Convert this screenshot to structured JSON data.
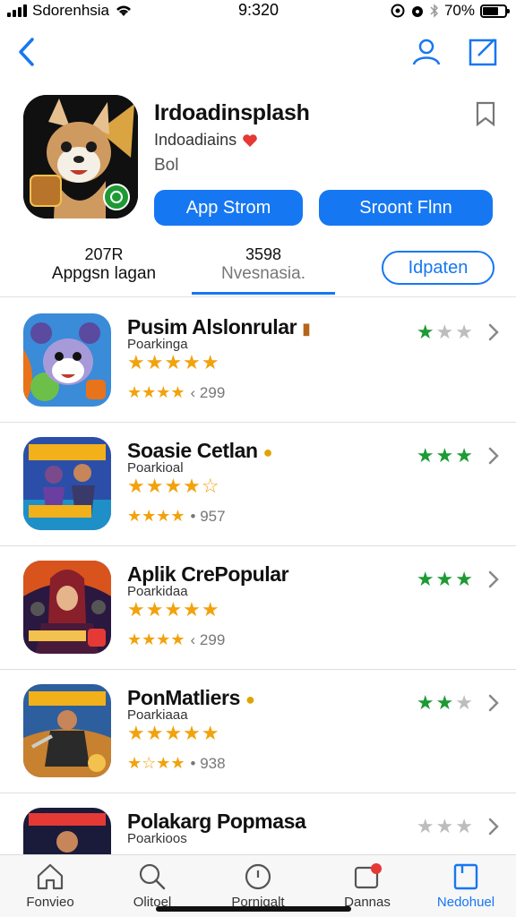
{
  "status_bar": {
    "carrier": "Sdorenhsia",
    "time": "9:320",
    "battery": "70%",
    "battery_level": 0.7
  },
  "hero": {
    "title": "Irdoadinsplash",
    "subtitle": "Indoadiains",
    "category": "Bol",
    "buttons": [
      "App Strom",
      "Sroont Flnn"
    ]
  },
  "tabs": [
    {
      "number": "207R",
      "label": "Appgsn lagan"
    },
    {
      "number": "3598",
      "label": "Nvesnasia."
    }
  ],
  "pill": {
    "label": "Idpaten"
  },
  "apps": [
    {
      "title": "Pusim Alslonrular",
      "developer": "Poarkinga",
      "stars_big": "★★★★★",
      "stars_small": "★★★★",
      "count": "‹ 299",
      "rating": 1,
      "accent": "#b5641a"
    },
    {
      "title": "Soasie Cetlan",
      "developer": "Poarkioal",
      "stars_big": "★★★★☆",
      "stars_small": "★★★★",
      "count": "• 957",
      "rating": 3,
      "accent": "#e0a400"
    },
    {
      "title": "Aplik CrePopular",
      "developer": "Poarkidaa",
      "stars_big": "★★★★★",
      "stars_small": "★★★★",
      "count": "‹ 299",
      "rating": 3,
      "accent": "#c2185b"
    },
    {
      "title": "PonMatliers",
      "developer": "Poarkiaaa",
      "stars_big": "★★★★★",
      "stars_small": "★☆★★",
      "count": "• 938",
      "rating": 2,
      "accent": "#e0a400"
    },
    {
      "title": "Polakarg Popmasa",
      "developer": "Poarkioos",
      "stars_big": "",
      "stars_small": "",
      "count": "",
      "rating": 0,
      "accent": "#1677f2"
    }
  ],
  "tabbar": [
    {
      "label": "Fonvieo",
      "icon": "home-icon"
    },
    {
      "label": "Olitoel",
      "icon": "search-icon"
    },
    {
      "label": "Porniqalt",
      "icon": "clock-icon"
    },
    {
      "label": "Dannas",
      "icon": "notifications-icon"
    },
    {
      "label": "Nedohuel",
      "icon": "updates-icon"
    }
  ],
  "colors": {
    "accent": "#1677f2",
    "star": "#f2a20c",
    "green": "#1e9a34"
  }
}
